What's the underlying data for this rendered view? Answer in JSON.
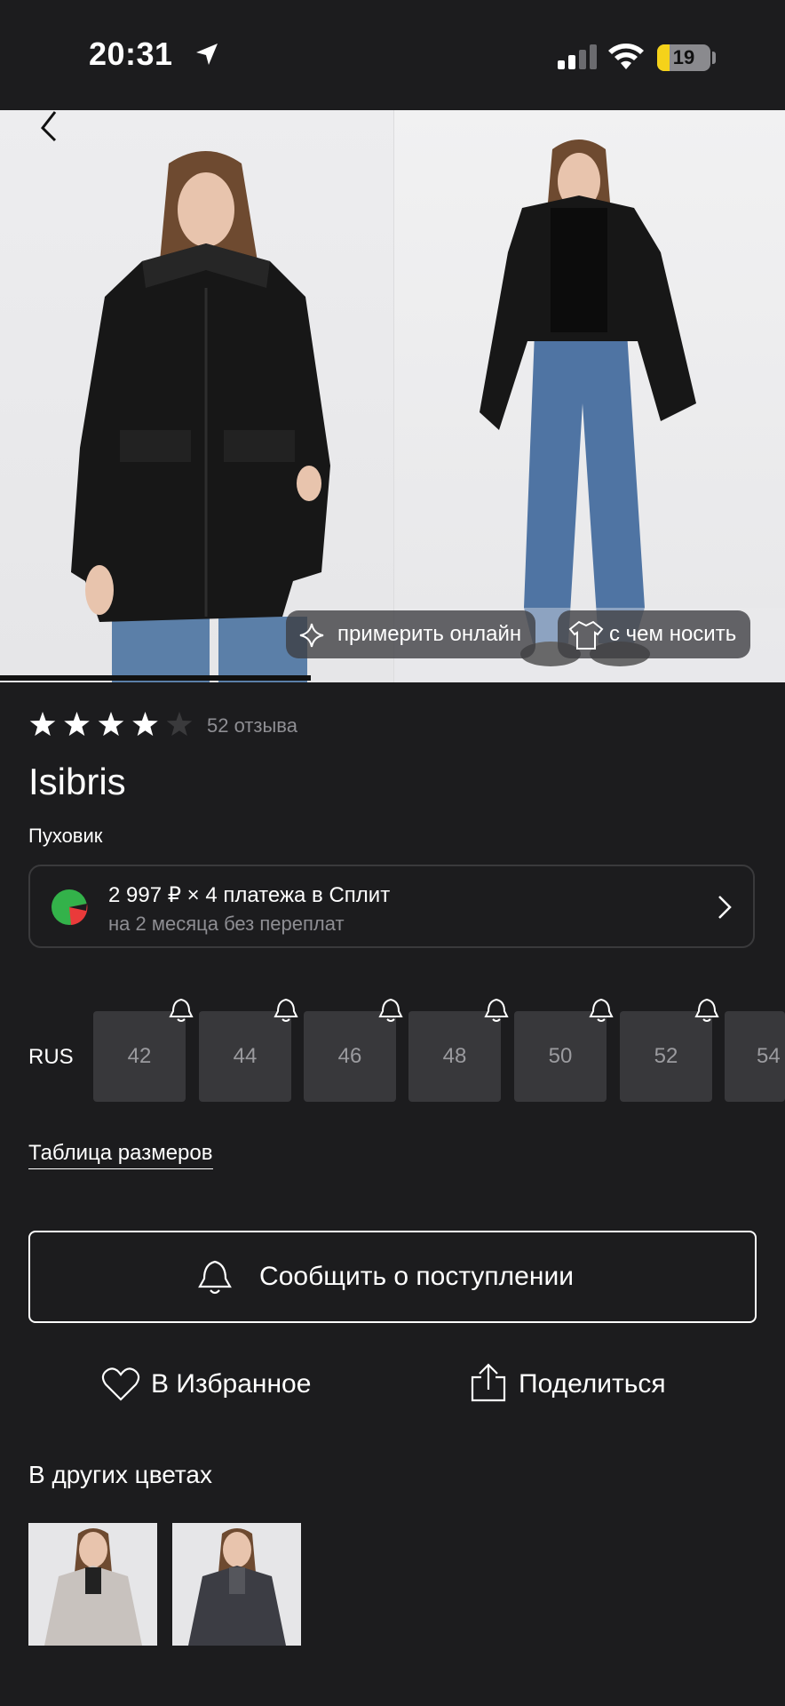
{
  "status_bar": {
    "time": "20:31",
    "battery": "19"
  },
  "gallery": {
    "try_on_label": "примерить онлайн",
    "what_to_wear_label": "с чем носить",
    "current_slide": 1
  },
  "product": {
    "rating": 4,
    "rating_max": 5,
    "reviews": "52 отзыва",
    "brand": "Isibris",
    "type": "Пуховик"
  },
  "split": {
    "title": "2 997 ₽ × 4 платежа в Сплит",
    "subtitle": "на 2 месяца без переплат"
  },
  "sizes": {
    "system": "RUS",
    "items": [
      "42",
      "44",
      "46",
      "48",
      "50",
      "52",
      "54"
    ]
  },
  "size_table_link": "Таблица размеров",
  "notify_button": "Сообщить о поступлении",
  "actions": {
    "favorite": "В Избранное",
    "share": "Поделиться"
  },
  "other_colors": {
    "title": "В других цветах"
  },
  "colors": {
    "background": "#1c1c1e",
    "box": "#38383b",
    "muted": "#8e8e93",
    "battery": "#f5d21a",
    "split_green": "#33b24a",
    "split_red": "#ea3a3a"
  }
}
